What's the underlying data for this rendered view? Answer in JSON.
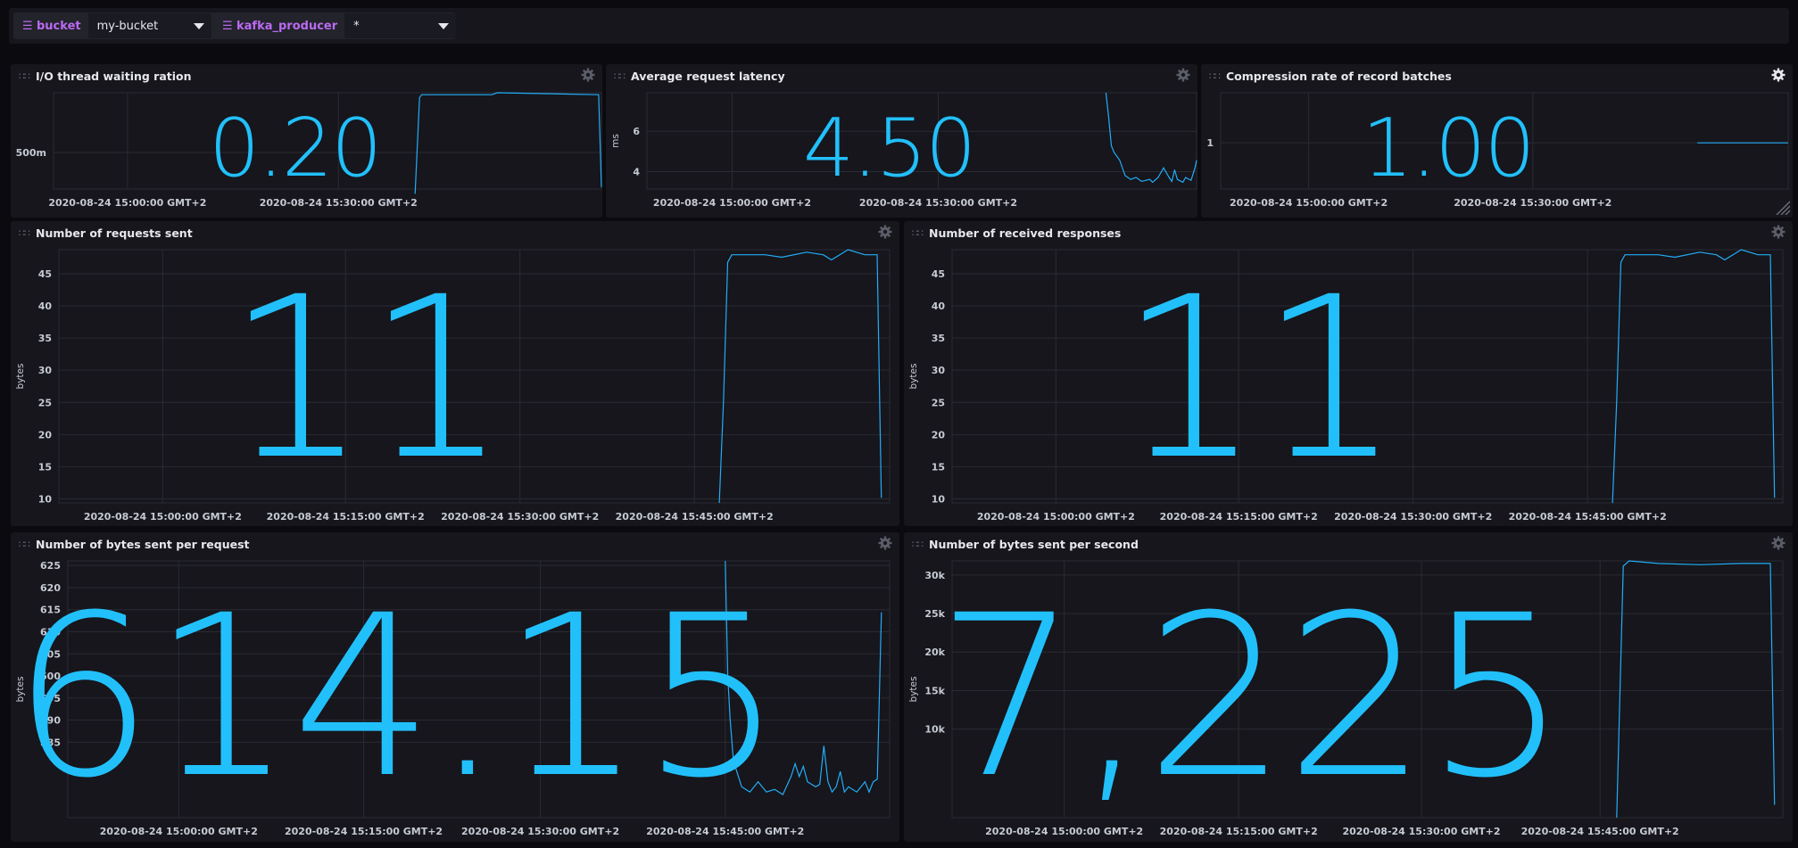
{
  "variables": [
    {
      "name": "bucket",
      "value": "my-bucket"
    },
    {
      "name": "kafka_producer",
      "value": "*"
    }
  ],
  "cells": [
    {
      "id": "io-thread",
      "title": "I/O thread waiting ration",
      "value": "0.20",
      "y_label": "",
      "y_ticks": [
        "500m"
      ],
      "x_ticks": [
        "2020-08-24 15:00:00 GMT+2",
        "2020-08-24 15:30:00 GMT+2"
      ],
      "gear_active": false
    },
    {
      "id": "avg-latency",
      "title": "Average request latency",
      "value": "4.50",
      "y_label": "ms",
      "y_ticks": [
        "6",
        "4"
      ],
      "x_ticks": [
        "2020-08-24 15:00:00 GMT+2",
        "2020-08-24 15:30:00 GMT+2"
      ],
      "gear_active": false
    },
    {
      "id": "compression",
      "title": "Compression rate of record batches",
      "value": "1.00",
      "y_label": "",
      "y_ticks": [
        "1"
      ],
      "x_ticks": [
        "2020-08-24 15:00:00 GMT+2",
        "2020-08-24 15:30:00 GMT+2"
      ],
      "gear_active": true
    },
    {
      "id": "requests-sent",
      "title": "Number of requests sent",
      "value": "11",
      "y_label": "bytes",
      "y_ticks": [
        "45",
        "40",
        "35",
        "30",
        "25",
        "20",
        "15",
        "10"
      ],
      "x_ticks": [
        "2020-08-24 15:00:00 GMT+2",
        "2020-08-24 15:15:00 GMT+2",
        "2020-08-24 15:30:00 GMT+2",
        "2020-08-24 15:45:00 GMT+2"
      ],
      "gear_active": false
    },
    {
      "id": "received-responses",
      "title": "Number of received responses",
      "value": "11",
      "y_label": "bytes",
      "y_ticks": [
        "45",
        "40",
        "35",
        "30",
        "25",
        "20",
        "15",
        "10"
      ],
      "x_ticks": [
        "2020-08-24 15:00:00 GMT+2",
        "2020-08-24 15:15:00 GMT+2",
        "2020-08-24 15:30:00 GMT+2",
        "2020-08-24 15:45:00 GMT+2"
      ],
      "gear_active": false
    },
    {
      "id": "bytes-per-request",
      "title": "Number of bytes sent per request",
      "value": "614.15",
      "y_label": "bytes",
      "y_ticks": [
        "625",
        "620",
        "615",
        "610",
        "605",
        "600",
        "595",
        "590",
        "585"
      ],
      "x_ticks": [
        "2020-08-24 15:00:00 GMT+2",
        "2020-08-24 15:15:00 GMT+2",
        "2020-08-24 15:30:00 GMT+2",
        "2020-08-24 15:45:00 GMT+2"
      ],
      "gear_active": false
    },
    {
      "id": "bytes-per-second",
      "title": "Number of bytes sent per second",
      "value": "7,225",
      "y_label": "bytes",
      "y_ticks": [
        "30k",
        "25k",
        "20k",
        "15k",
        "10k"
      ],
      "x_ticks": [
        "2020-08-24 15:00:00 GMT+2",
        "2020-08-24 15:15:00 GMT+2",
        "2020-08-24 15:30:00 GMT+2",
        "2020-08-24 15:45:00 GMT+2"
      ],
      "gear_active": false
    }
  ],
  "colors": {
    "line": "#22adf6",
    "big_value": "#22c0fb",
    "variable": "#b96bf1",
    "grid": "#2a2a33",
    "panel": "#16161c"
  }
}
